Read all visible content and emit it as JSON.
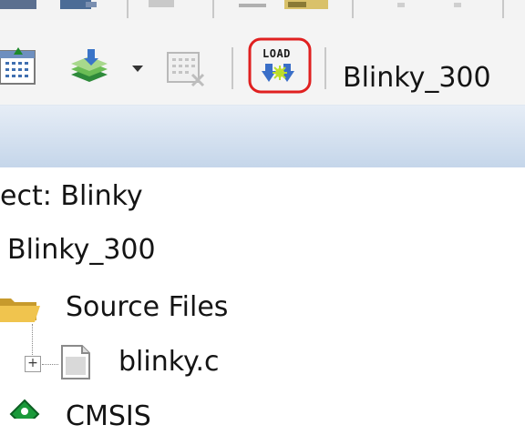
{
  "toolbar": {
    "load_button": {
      "label": "LOAD",
      "highlight_color": "#e02020"
    },
    "target_select": {
      "value": "Blinky_300"
    }
  },
  "project_tree": {
    "project_label": "ect: Blinky",
    "target_label": "Blinky_300",
    "group_label": "Source Files",
    "file_label": "blinky.c",
    "component_label": "CMSIS"
  }
}
